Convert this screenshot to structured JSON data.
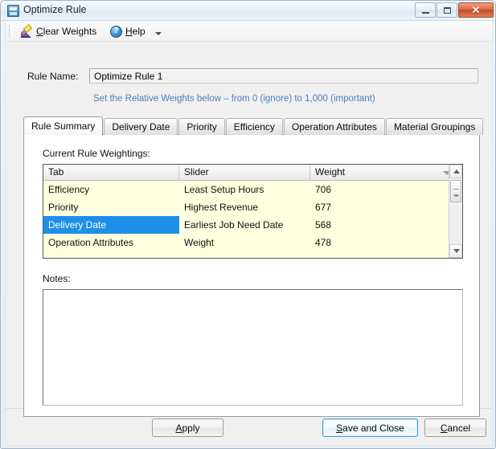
{
  "window": {
    "title": "Optimize Rule",
    "icon": "grid-document-icon",
    "controls": {
      "minimize": "minimize-button",
      "maximize": "maximize-button",
      "close_glyph": "✕"
    }
  },
  "toolbar": {
    "clear_weights": {
      "label_pre": "",
      "accel": "C",
      "label_post": "lear Weights",
      "icon": "highlighter-clear-icon"
    },
    "help": {
      "label_pre": "",
      "accel": "H",
      "label_post": "elp",
      "icon": "question-circle-icon",
      "has_dropdown": true
    }
  },
  "form": {
    "rule_name_label": "Rule Name:",
    "rule_name_value": "Optimize Rule 1",
    "rule_name_placeholder": "Optimize Rule 1",
    "hint": "Set the Relative Weights below – from 0 (ignore) to 1,000 (important)",
    "hint_color": "#4f7bbf"
  },
  "tabs": {
    "active_index": 0,
    "items": [
      {
        "label": "Rule Summary"
      },
      {
        "label": "Delivery Date"
      },
      {
        "label": "Priority"
      },
      {
        "label": "Efficiency"
      },
      {
        "label": "Operation Attributes"
      },
      {
        "label": "Material Groupings"
      }
    ]
  },
  "rule_summary": {
    "grid_label": "Current Rule Weightings:",
    "grid": {
      "columns": [
        "Tab",
        "Slider",
        "Weight"
      ],
      "selected_row_index": 2,
      "selection_color": "#1d8fe8",
      "row_background": "#ffffdf",
      "rows": [
        {
          "tab": "Efficiency",
          "slider": "Least Setup Hours",
          "weight": "706"
        },
        {
          "tab": "Priority",
          "slider": "Highest Revenue",
          "weight": "677"
        },
        {
          "tab": "Delivery Date",
          "slider": "Earliest Job Need Date",
          "weight": "568"
        },
        {
          "tab": "Operation Attributes",
          "slider": "Weight",
          "weight": "478"
        }
      ]
    },
    "notes_label": "Notes:",
    "notes_value": "",
    "notes_placeholder": ""
  },
  "buttons": {
    "apply": {
      "accel": "A",
      "rest": "pply"
    },
    "save_and_close": {
      "pre": "",
      "accel": "S",
      "rest": "ave and Close"
    },
    "cancel": {
      "pre": "",
      "accel": "C",
      "rest": "ancel"
    }
  }
}
